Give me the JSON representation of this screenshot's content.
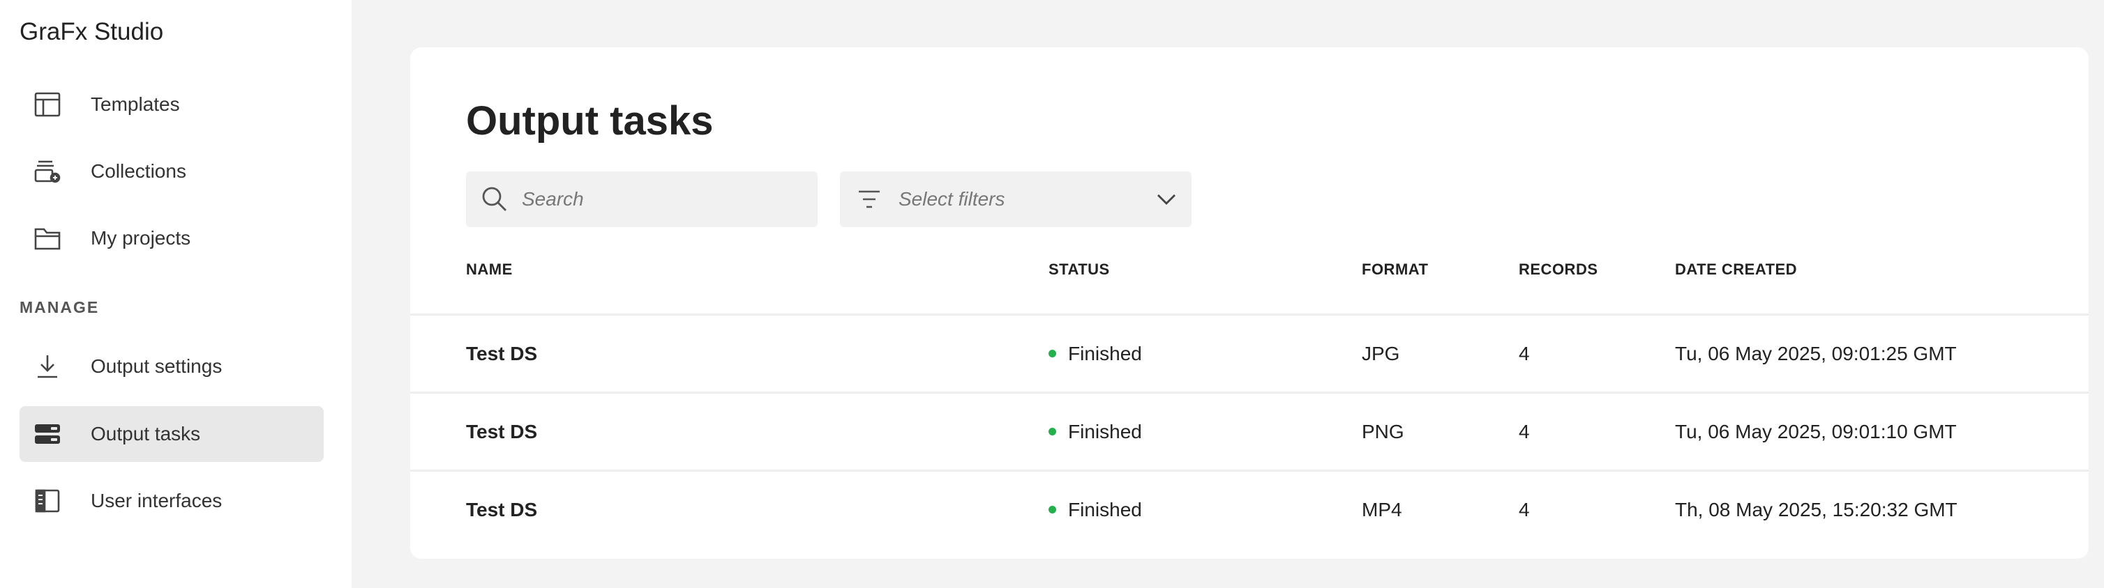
{
  "app": {
    "title": "GraFx Studio"
  },
  "sidebar": {
    "items": [
      {
        "label": "Templates",
        "icon": "template-icon"
      },
      {
        "label": "Collections",
        "icon": "collections-icon"
      },
      {
        "label": "My projects",
        "icon": "folder-icon"
      }
    ],
    "manage_label": "MANAGE",
    "manage_items": [
      {
        "label": "Output settings",
        "icon": "download-icon"
      },
      {
        "label": "Output tasks",
        "icon": "output-tasks-icon",
        "active": true
      },
      {
        "label": "User interfaces",
        "icon": "user-interface-icon"
      }
    ]
  },
  "main": {
    "title": "Output tasks",
    "search": {
      "placeholder": "Search",
      "value": ""
    },
    "filter": {
      "placeholder": "Select filters"
    },
    "table": {
      "columns": [
        "NAME",
        "STATUS",
        "FORMAT",
        "RECORDS",
        "DATE CREATED"
      ],
      "rows": [
        {
          "name": "Test DS",
          "status": "Finished",
          "format": "JPG",
          "records": "4",
          "date": "Tu, 06 May 2025, 09:01:25 GMT"
        },
        {
          "name": "Test DS",
          "status": "Finished",
          "format": "PNG",
          "records": "4",
          "date": "Tu, 06 May 2025, 09:01:10 GMT"
        },
        {
          "name": "Test DS",
          "status": "Finished",
          "format": "MP4",
          "records": "4",
          "date": "Th, 08 May 2025, 15:20:32 GMT"
        }
      ]
    }
  },
  "colors": {
    "status_finished": "#22b14c",
    "active_item_bg": "#e8e8e8",
    "page_bg": "#f3f3f3"
  }
}
